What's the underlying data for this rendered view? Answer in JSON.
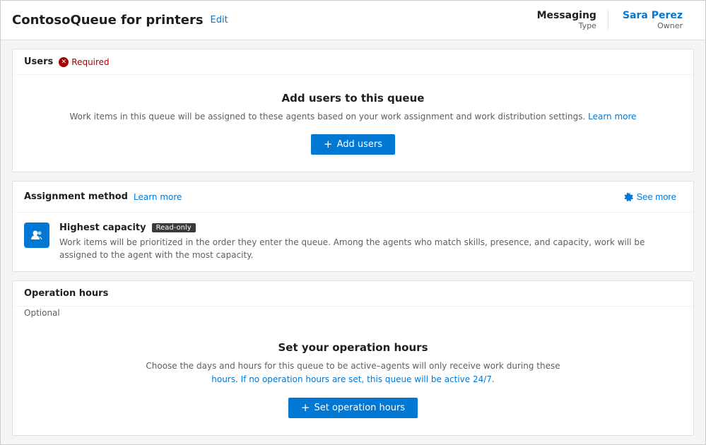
{
  "header": {
    "title": "ContosoQueue for printers",
    "edit_label": "Edit",
    "meta": [
      {
        "value": "Messaging",
        "label": "Type"
      },
      {
        "value": "Sara Perez",
        "label": "Owner"
      }
    ]
  },
  "users_section": {
    "title": "Users",
    "required_label": "Required",
    "body_title": "Add users to this queue",
    "body_desc_prefix": "Work items in this queue will be assigned to these agents based on your work assignment and work distribution settings.",
    "learn_more_inline": "Learn more",
    "add_users_label": "+ Add users"
  },
  "assignment_section": {
    "title": "Assignment method",
    "learn_more_label": "Learn more",
    "see_more_label": "See more",
    "assignment_title": "Highest capacity",
    "readonly_label": "Read-only",
    "assignment_desc": "Work items will be prioritized in the order they enter the queue. Among the agents who match skills, presence, and capacity, work will be assigned to the agent with the most capacity."
  },
  "operation_hours_section": {
    "title": "Operation hours",
    "optional_label": "Optional",
    "body_title": "Set your operation hours",
    "body_desc_line1": "Choose the days and hours for this queue to be active–agents will only receive work during these",
    "body_desc_line2": "hours. If no operation hours are set, this queue will be active 24/7.",
    "set_hours_label": "Set operation hours"
  }
}
